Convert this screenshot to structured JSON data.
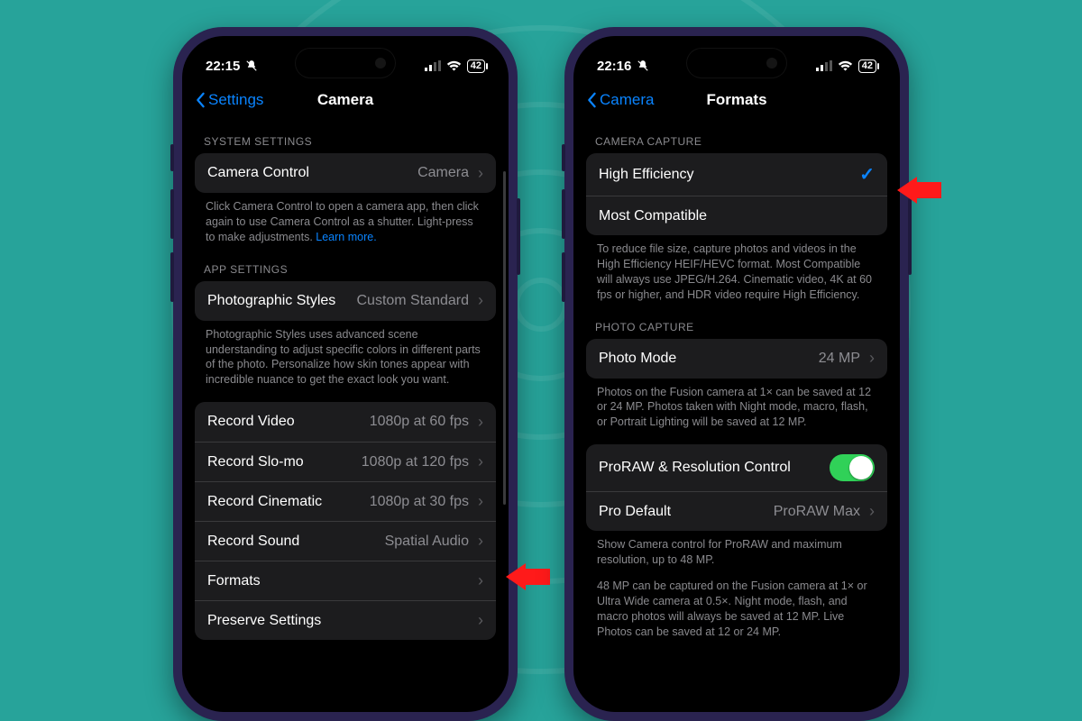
{
  "bg_accent": "#27a39a",
  "link_color": "#0a84ff",
  "phone1": {
    "status": {
      "time": "22:15",
      "battery": "42"
    },
    "nav": {
      "back": "Settings",
      "title": "Camera"
    },
    "system_settings_header": "SYSTEM SETTINGS",
    "camera_control": {
      "label": "Camera Control",
      "value": "Camera"
    },
    "camera_control_footer": "Click Camera Control to open a camera app, then click again to use Camera Control as a shutter. Light-press to make adjustments. ",
    "camera_control_learn_more": "Learn more.",
    "app_settings_header": "APP SETTINGS",
    "photo_styles": {
      "label": "Photographic Styles",
      "value": "Custom Standard"
    },
    "photo_styles_footer": "Photographic Styles uses advanced scene understanding to adjust specific colors in different parts of the photo. Personalize how skin tones appear with incredible nuance to get the exact look you want.",
    "rows": {
      "record_video": {
        "label": "Record Video",
        "value": "1080p at 60 fps"
      },
      "record_slomo": {
        "label": "Record Slo-mo",
        "value": "1080p at 120 fps"
      },
      "record_cinematic": {
        "label": "Record Cinematic",
        "value": "1080p at 30 fps"
      },
      "record_sound": {
        "label": "Record Sound",
        "value": "Spatial Audio"
      },
      "formats": {
        "label": "Formats"
      },
      "preserve": {
        "label": "Preserve Settings"
      }
    }
  },
  "phone2": {
    "status": {
      "time": "22:16",
      "battery": "42"
    },
    "nav": {
      "back": "Camera",
      "title": "Formats"
    },
    "camera_capture_header": "CAMERA CAPTURE",
    "high_efficiency": "High Efficiency",
    "most_compatible": "Most Compatible",
    "camera_capture_footer": "To reduce file size, capture photos and videos in the High Efficiency HEIF/HEVC format. Most Compatible will always use JPEG/H.264. Cinematic video, 4K at 60 fps or higher, and HDR video require High Efficiency.",
    "photo_capture_header": "PHOTO CAPTURE",
    "photo_mode": {
      "label": "Photo Mode",
      "value": "24 MP"
    },
    "photo_mode_footer": "Photos on the Fusion camera at 1× can be saved at 12 or 24 MP. Photos taken with Night mode, macro, flash, or Portrait Lighting will be saved at 12 MP.",
    "proraw_label": "ProRAW & Resolution Control",
    "pro_default": {
      "label": "Pro Default",
      "value": "ProRAW Max"
    },
    "proraw_footer1": "Show Camera control for ProRAW and maximum resolution, up to 48 MP.",
    "proraw_footer2": "48 MP can be captured on the Fusion camera at 1× or Ultra Wide camera at 0.5×. Night mode, flash, and macro photos will always be saved at 12 MP. Live Photos can be saved at 12 or 24 MP."
  }
}
